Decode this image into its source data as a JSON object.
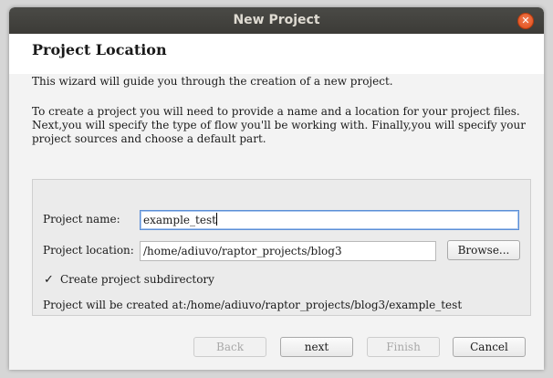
{
  "window": {
    "title": "New Project",
    "close_glyph": "✕"
  },
  "header": {
    "title": "Project Location"
  },
  "intro": {
    "line1": "This wizard will guide you through the creation of a new project.",
    "paragraph": "To create a project you will need to provide a name and a location for your project files. Next,you will specify the type of flow you'll be working with. Finally,you will specify your project sources and choose a default part."
  },
  "form": {
    "name_label": "Project name:",
    "name_value": "example_test",
    "location_label": "Project location:",
    "location_value": "/home/adiuvo/raptor_projects/blog3",
    "browse_label": "Browse...",
    "subdir_checked": true,
    "subdir_glyph": "✓",
    "subdir_label": "Create project subdirectory",
    "created_at_label": "Project will be created at:",
    "created_at_path": "/home/adiuvo/raptor_projects/blog3/example_test"
  },
  "footer": {
    "back_label": "Back",
    "next_label": "next",
    "finish_label": "Finish",
    "cancel_label": "Cancel"
  },
  "colors": {
    "titlebar": "#3c3b37",
    "close_button": "#df4b16",
    "focus_border": "#5b8ed6"
  },
  "icons": {
    "close": "close-icon",
    "checkbox": "checkmark-icon"
  }
}
